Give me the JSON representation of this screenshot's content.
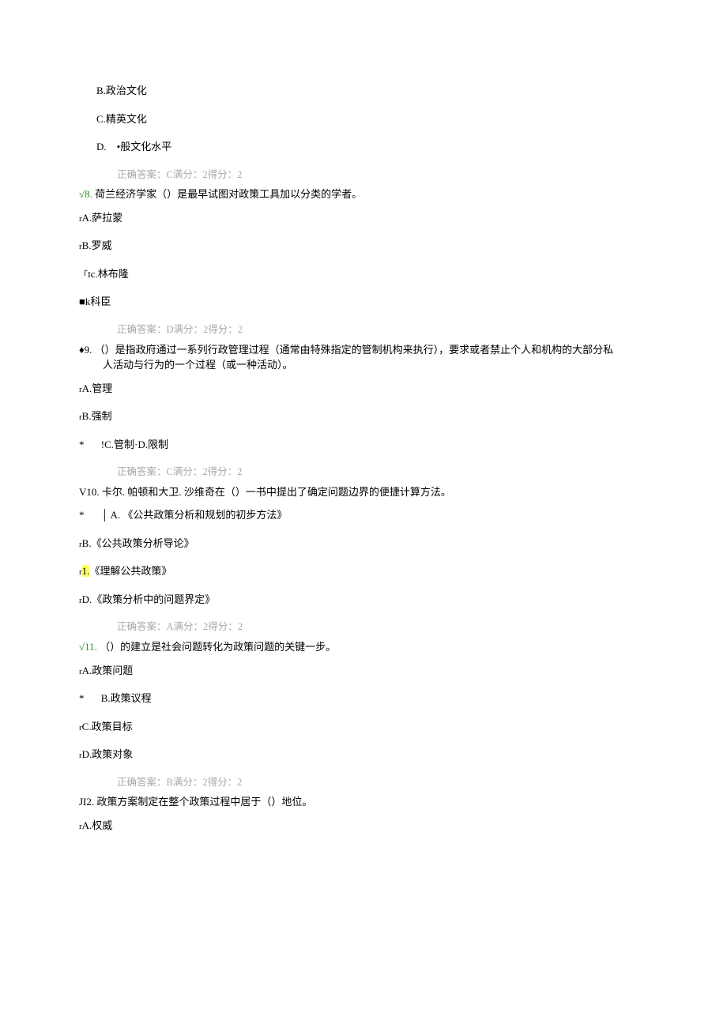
{
  "q7": {
    "optB": "B.政治文化",
    "optC": "C.精英文化",
    "optD_letter": "D.",
    "optD_text": "•般文化水平",
    "answer": "正确答案：C满分：2得分：2"
  },
  "q8": {
    "num_prefix": "√8.",
    "stem": "荷兰经济学家（）是最早试图对政策工具加以分类的学者。",
    "optA_prefix": "r",
    "optA": "A.萨拉蒙",
    "optB_prefix": "r",
    "optB": "B.罗威",
    "optC_prefix": "「I",
    "optC": "c.林布隆",
    "optD_prefix": "■k",
    "optD": "科臣",
    "answer": "正确答案：D满分：2得分：2"
  },
  "q9": {
    "num_prefix": "♦9.",
    "stem_line1": "（）是指政府通过一系列行政管理过程（通常由特殊指定的管制机构来执行），要求或者禁止个人和机构的大部分私",
    "stem_line2": "人活动与行为的一个过程（或一种活动）。",
    "optA_prefix": "r",
    "optA": "A.管理",
    "optB_prefix": "r",
    "optB": "B.强制",
    "optCD_star": "*",
    "optCD": "!C.管制·D.限制",
    "answer": "正确答案：C满分：2得分：2"
  },
  "q10": {
    "num_prefix": "V10.",
    "stem": "卡尔. 帕顿和大卫. 沙维奇在（）一书中提出了确定问题边界的便捷计算方法。",
    "optA_star": "*",
    "optA_bar": "│",
    "optA_letter": "A.",
    "optA": "《公共政策分析和规划的初步方法》",
    "optB_prefix": "r",
    "optB": "B.《公共政策分析导论》",
    "optC_prefix": "r",
    "optC_hl": "1.",
    "optC": "《理解公共政策》",
    "optD_prefix": "r",
    "optD": "D.《政策分析中的问题界定》",
    "answer": "正确答案：A满分：2得分：2"
  },
  "q11": {
    "num_prefix": "√11.",
    "stem": "（）的建立是社会问题转化为政策问题的关键一步。",
    "optA_prefix": "r",
    "optA": "A.政策问题",
    "optB_star": "*",
    "optB": "B.政策议程",
    "optC_prefix": "r",
    "optC": "C.政策目标",
    "optD_prefix": "r",
    "optD": "D.政策对象",
    "answer": "正确答案：B满分：2得分：2"
  },
  "q12": {
    "num_prefix": "JI2.",
    "stem": "政策方案制定在整个政策过程中居于（）地位。",
    "optA_prefix": "r",
    "optA": "A.权威"
  }
}
